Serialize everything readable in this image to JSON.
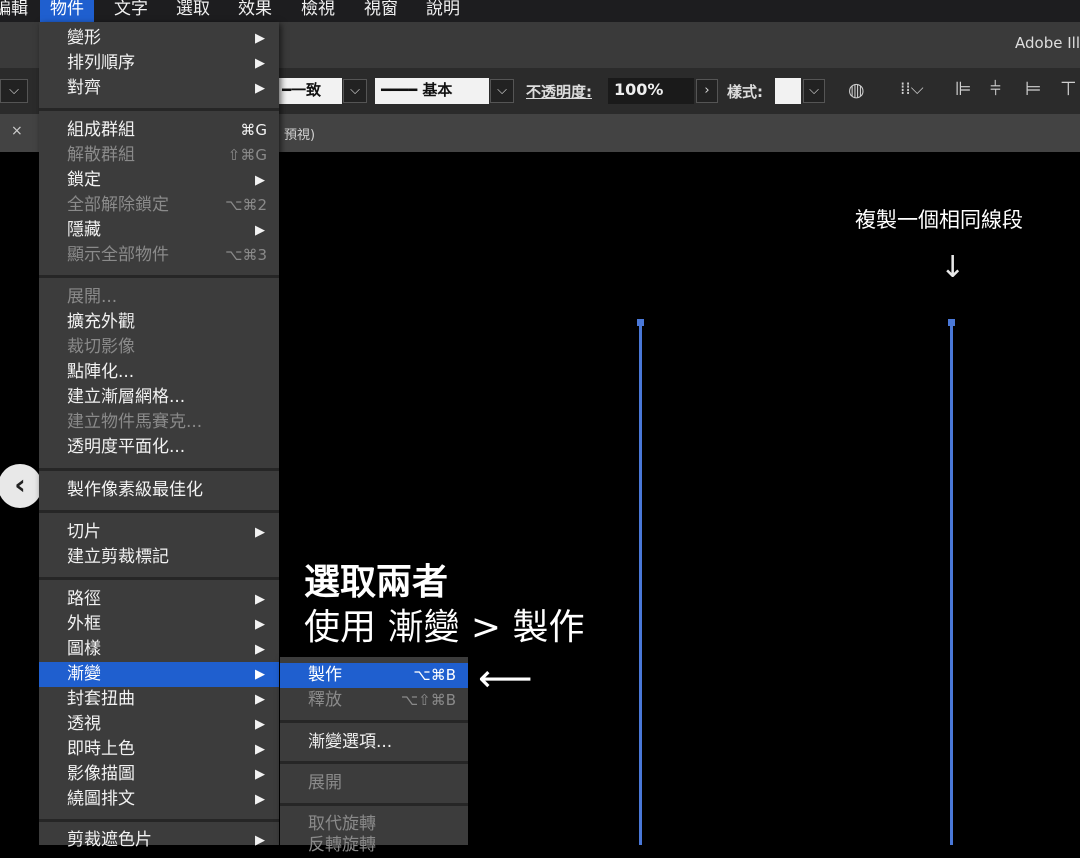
{
  "menubar": {
    "items": [
      "編輯",
      "物件",
      "文字",
      "選取",
      "效果",
      "檢視",
      "視窗",
      "說明"
    ],
    "active": "物件"
  },
  "app_title": "Adobe Ill",
  "controlbar": {
    "stroke_uniform": "一致",
    "stroke_basic": "基本",
    "opacity_label": "不透明度:",
    "opacity_value": "100%",
    "style_label": "樣式:"
  },
  "tab": {
    "close": "×",
    "title_fragment": "預視)"
  },
  "object_menu": {
    "items": [
      {
        "label": "變形",
        "submenu": true
      },
      {
        "label": "排列順序",
        "submenu": true
      },
      {
        "label": "對齊",
        "submenu": true
      },
      {
        "label": "組成群組",
        "shortcut": "⌘G"
      },
      {
        "label": "解散群組",
        "shortcut": "⇧⌘G",
        "disabled": true
      },
      {
        "label": "鎖定",
        "submenu": true
      },
      {
        "label": "全部解除鎖定",
        "shortcut": "⌥⌘2",
        "disabled": true
      },
      {
        "label": "隱藏",
        "submenu": true
      },
      {
        "label": "顯示全部物件",
        "shortcut": "⌥⌘3",
        "disabled": true
      },
      {
        "label": "展開...",
        "disabled": true
      },
      {
        "label": "擴充外觀"
      },
      {
        "label": "裁切影像",
        "disabled": true
      },
      {
        "label": "點陣化..."
      },
      {
        "label": "建立漸層網格..."
      },
      {
        "label": "建立物件馬賽克...",
        "disabled": true
      },
      {
        "label": "透明度平面化..."
      },
      {
        "label": "製作像素級最佳化"
      },
      {
        "label": "切片",
        "submenu": true
      },
      {
        "label": "建立剪裁標記"
      },
      {
        "label": "路徑",
        "submenu": true
      },
      {
        "label": "外框",
        "submenu": true
      },
      {
        "label": "圖樣",
        "submenu": true
      },
      {
        "label": "漸變",
        "submenu": true,
        "highlighted": true
      },
      {
        "label": "封套扭曲",
        "submenu": true
      },
      {
        "label": "透視",
        "submenu": true
      },
      {
        "label": "即時上色",
        "submenu": true
      },
      {
        "label": "影像描圖",
        "submenu": true
      },
      {
        "label": "繞圖排文",
        "submenu": true
      },
      {
        "label": "剪裁遮色片",
        "submenu": true
      }
    ]
  },
  "blend_submenu": {
    "items": [
      {
        "label": "製作",
        "shortcut": "⌥⌘B",
        "highlighted": true
      },
      {
        "label": "釋放",
        "shortcut": "⌥⇧⌘B",
        "disabled": true
      },
      {
        "label": "漸變選項..."
      },
      {
        "label": "展開",
        "disabled": true
      },
      {
        "label": "取代旋轉",
        "disabled": true
      },
      {
        "label": "反轉旋轉",
        "disabled": true
      }
    ]
  },
  "annotations": {
    "copy_segment": "複製一個相同線段",
    "down_arrow": "↓",
    "select_both": "選取兩者",
    "use_blend": "使用 漸變 > 製作",
    "left_arrow": "⟵"
  },
  "nav_prev": "‹",
  "colors": {
    "menu_highlight": "#1f5fcf",
    "line_blue": "#4a78d8"
  }
}
